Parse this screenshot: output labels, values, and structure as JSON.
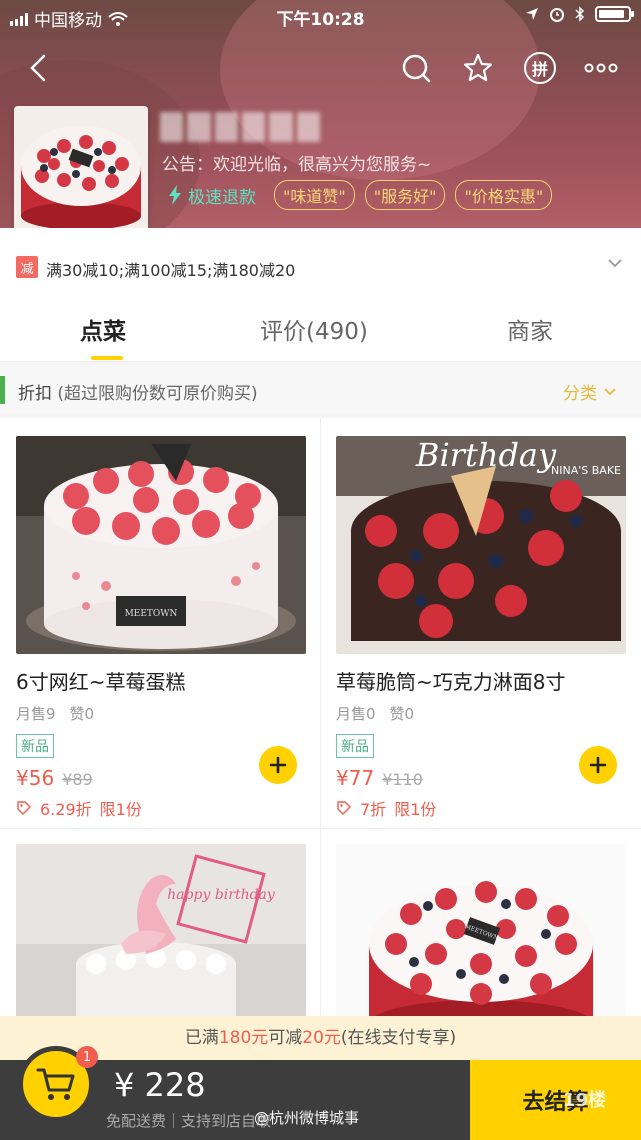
{
  "status_bar": {
    "carrier": "中国移动",
    "time": "下午10:28"
  },
  "store": {
    "notice": "公告：欢迎光临，很高兴为您服务~",
    "refund_label": "极速退款",
    "tags": [
      "\"味道赞\"",
      "\"服务好\"",
      "\"价格实惠\""
    ]
  },
  "promo": {
    "badge": "减",
    "text": "满30减10;满100减15;满180减20"
  },
  "tabs": [
    "点菜",
    "评价(490)",
    "商家"
  ],
  "category": {
    "title": "折扣",
    "subtitle": "(超过限购份数可原价购买)",
    "sort_label": "分类"
  },
  "products": [
    {
      "title": "6寸网红~草莓蛋糕",
      "monthly_sales": "月售9",
      "likes": "赞0",
      "badge": "新品",
      "price": "¥56",
      "old_price": "¥89",
      "discount": "6.29折",
      "limit": "限1份",
      "img_label": "MEETOWN"
    },
    {
      "title": "草莓脆筒~巧克力淋面8寸",
      "monthly_sales": "月售0",
      "likes": "赞0",
      "badge": "新品",
      "price": "¥77",
      "old_price": "¥110",
      "discount": "7折",
      "limit": "限1份",
      "img_label": "NINA'S BAKE",
      "img_script": "Birthday"
    },
    {
      "img_script": "happy birthday"
    },
    {
      "img_label": "MEETOWN"
    }
  ],
  "threshold": {
    "prefix": "已满",
    "amount1": "180元",
    "middle": "可减",
    "amount2": "20元",
    "suffix": "(在线支付专享)"
  },
  "cart": {
    "count": "1",
    "total": "¥ 228",
    "delivery": "免配送费｜支持到店自取",
    "checkout": "去结算"
  },
  "watermark": "@杭州微博城事",
  "watermark_site": "19楼",
  "colors": {
    "accent": "#ffd100",
    "price": "#f25c4d",
    "header": "#8a4d52"
  }
}
